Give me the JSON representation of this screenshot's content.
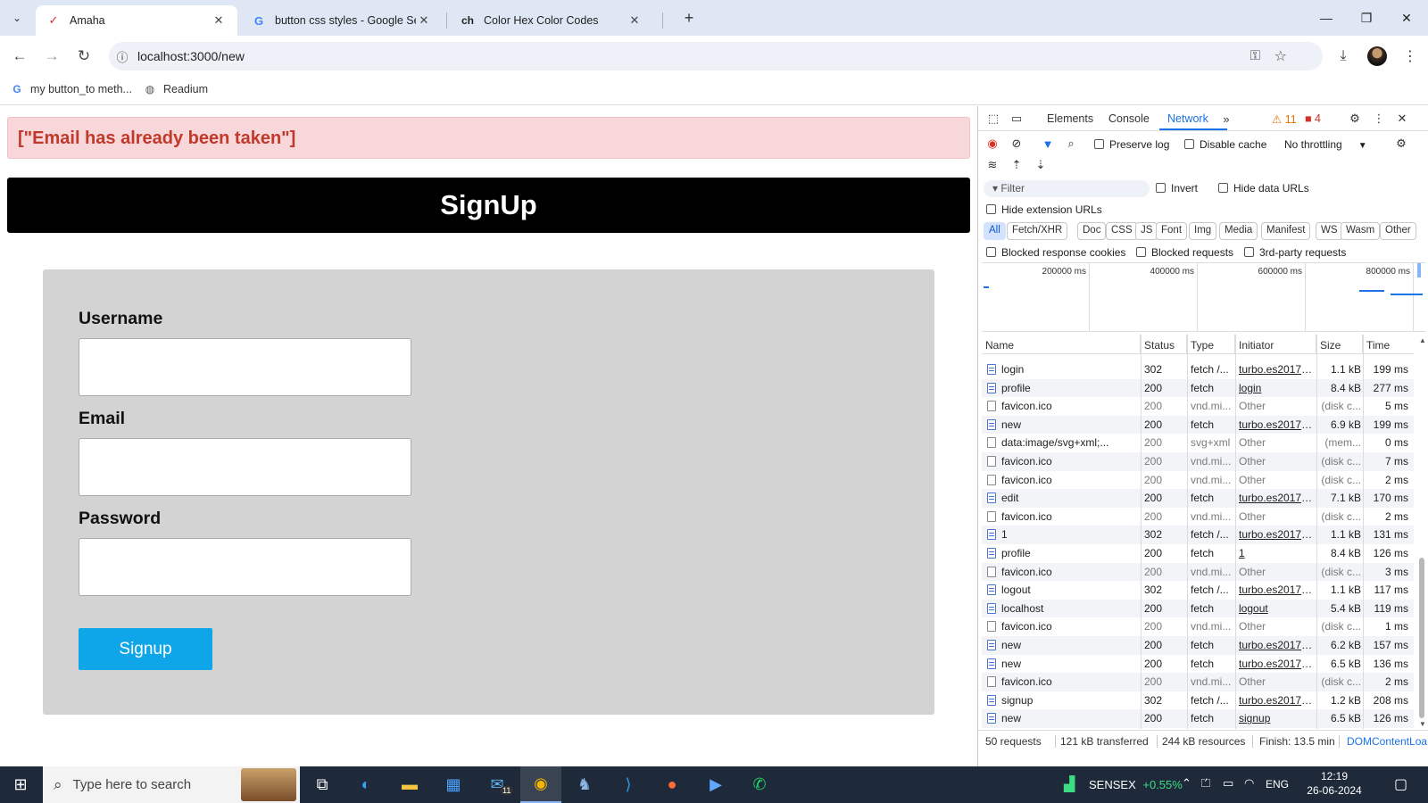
{
  "browser": {
    "tabs": [
      {
        "title": "Amaha",
        "favicon": "A"
      },
      {
        "title": "button css styles - Google Search",
        "favicon": "G"
      },
      {
        "title": "Color Hex Color Codes",
        "favicon": "ch"
      }
    ],
    "url": "localhost:3000/new",
    "bookmarks": [
      {
        "label": "my button_to meth..."
      },
      {
        "label": "Readium"
      }
    ]
  },
  "page": {
    "alert": "[\"Email has already been taken\"]",
    "banner_title": "SignUp",
    "form": {
      "username_label": "Username",
      "email_label": "Email",
      "password_label": "Password",
      "submit_label": "Signup"
    }
  },
  "devtools": {
    "tabs": [
      "Elements",
      "Console",
      "Network"
    ],
    "warnings": "11",
    "errors": "4",
    "preserve_log": "Preserve log",
    "disable_cache": "Disable cache",
    "throttling": "No throttling",
    "filter_placeholder": "Filter",
    "invert": "Invert",
    "hide_data_urls": "Hide data URLs",
    "hide_extension_urls": "Hide extension URLs",
    "type_filters": [
      "All",
      "Fetch/XHR",
      "Doc",
      "CSS",
      "JS",
      "Font",
      "Img",
      "Media",
      "Manifest",
      "WS",
      "Wasm",
      "Other"
    ],
    "blocked_response_cookies": "Blocked response cookies",
    "blocked_requests": "Blocked requests",
    "third_party_requests": "3rd-party requests",
    "overview_ticks": [
      "200000 ms",
      "400000 ms",
      "600000 ms",
      "800000 ms"
    ],
    "columns": [
      "Name",
      "Status",
      "Type",
      "Initiator",
      "Size",
      "Time"
    ],
    "requests": [
      {
        "name": "login",
        "status": "302",
        "type": "fetch /...",
        "initiator": "turbo.es2017-es",
        "size": "1.1 kB",
        "time": "199 ms",
        "kind": "doc",
        "dim": false,
        "init_link": true
      },
      {
        "name": "profile",
        "status": "200",
        "type": "fetch",
        "initiator": "login",
        "size": "8.4 kB",
        "time": "277 ms",
        "kind": "doc",
        "dim": false,
        "init_link": true
      },
      {
        "name": "favicon.ico",
        "status": "200",
        "type": "vnd.mi...",
        "initiator": "Other",
        "size": "(disk c...",
        "time": "5 ms",
        "kind": "img",
        "dim": true,
        "init_link": false
      },
      {
        "name": "new",
        "status": "200",
        "type": "fetch",
        "initiator": "turbo.es2017-es",
        "size": "6.9 kB",
        "time": "199 ms",
        "kind": "doc",
        "dim": false,
        "init_link": true
      },
      {
        "name": "data:image/svg+xml;...",
        "status": "200",
        "type": "svg+xml",
        "initiator": "Other",
        "size": "(mem...",
        "time": "0 ms",
        "kind": "img",
        "dim": true,
        "init_link": false
      },
      {
        "name": "favicon.ico",
        "status": "200",
        "type": "vnd.mi...",
        "initiator": "Other",
        "size": "(disk c...",
        "time": "7 ms",
        "kind": "img",
        "dim": true,
        "init_link": false
      },
      {
        "name": "favicon.ico",
        "status": "200",
        "type": "vnd.mi...",
        "initiator": "Other",
        "size": "(disk c...",
        "time": "2 ms",
        "kind": "img",
        "dim": true,
        "init_link": false
      },
      {
        "name": "edit",
        "status": "200",
        "type": "fetch",
        "initiator": "turbo.es2017-es",
        "size": "7.1 kB",
        "time": "170 ms",
        "kind": "doc",
        "dim": false,
        "init_link": true
      },
      {
        "name": "favicon.ico",
        "status": "200",
        "type": "vnd.mi...",
        "initiator": "Other",
        "size": "(disk c...",
        "time": "2 ms",
        "kind": "img",
        "dim": true,
        "init_link": false
      },
      {
        "name": "1",
        "status": "302",
        "type": "fetch /...",
        "initiator": "turbo.es2017-es",
        "size": "1.1 kB",
        "time": "131 ms",
        "kind": "doc",
        "dim": false,
        "init_link": true
      },
      {
        "name": "profile",
        "status": "200",
        "type": "fetch",
        "initiator": "1",
        "size": "8.4 kB",
        "time": "126 ms",
        "kind": "doc",
        "dim": false,
        "init_link": true
      },
      {
        "name": "favicon.ico",
        "status": "200",
        "type": "vnd.mi...",
        "initiator": "Other",
        "size": "(disk c...",
        "time": "3 ms",
        "kind": "img",
        "dim": true,
        "init_link": false
      },
      {
        "name": "logout",
        "status": "302",
        "type": "fetch /...",
        "initiator": "turbo.es2017-es",
        "size": "1.1 kB",
        "time": "117 ms",
        "kind": "doc",
        "dim": false,
        "init_link": true
      },
      {
        "name": "localhost",
        "status": "200",
        "type": "fetch",
        "initiator": "logout",
        "size": "5.4 kB",
        "time": "119 ms",
        "kind": "doc",
        "dim": false,
        "init_link": true
      },
      {
        "name": "favicon.ico",
        "status": "200",
        "type": "vnd.mi...",
        "initiator": "Other",
        "size": "(disk c...",
        "time": "1 ms",
        "kind": "img",
        "dim": true,
        "init_link": false
      },
      {
        "name": "new",
        "status": "200",
        "type": "fetch",
        "initiator": "turbo.es2017-es",
        "size": "6.2 kB",
        "time": "157 ms",
        "kind": "doc",
        "dim": false,
        "init_link": true
      },
      {
        "name": "new",
        "status": "200",
        "type": "fetch",
        "initiator": "turbo.es2017-es",
        "size": "6.5 kB",
        "time": "136 ms",
        "kind": "doc",
        "dim": false,
        "init_link": true
      },
      {
        "name": "favicon.ico",
        "status": "200",
        "type": "vnd.mi...",
        "initiator": "Other",
        "size": "(disk c...",
        "time": "2 ms",
        "kind": "img",
        "dim": true,
        "init_link": false
      },
      {
        "name": "signup",
        "status": "302",
        "type": "fetch /...",
        "initiator": "turbo.es2017-es",
        "size": "1.2 kB",
        "time": "208 ms",
        "kind": "doc",
        "dim": false,
        "init_link": true
      },
      {
        "name": "new",
        "status": "200",
        "type": "fetch",
        "initiator": "signup",
        "size": "6.5 kB",
        "time": "126 ms",
        "kind": "doc",
        "dim": false,
        "init_link": true
      }
    ],
    "status_bar": {
      "requests": "50 requests",
      "transferred": "121 kB transferred",
      "resources": "244 kB resources",
      "finish": "Finish: 13.5 min",
      "dcl": "DOMContentLoa"
    }
  },
  "taskbar": {
    "search_placeholder": "Type here to search",
    "sensex_label": "SENSEX",
    "sensex_change": "+0.55%",
    "language": "ENG",
    "time": "12:19",
    "date": "26-06-2024",
    "mail_badge": "11"
  },
  "colors": {
    "accent": "#1a73e8",
    "signup_button": "#0ea5e9",
    "alert_bg": "#f8d7da",
    "alert_text": "#c0392b",
    "form_bg": "#d3d3d3",
    "positive": "#3ddc84"
  }
}
